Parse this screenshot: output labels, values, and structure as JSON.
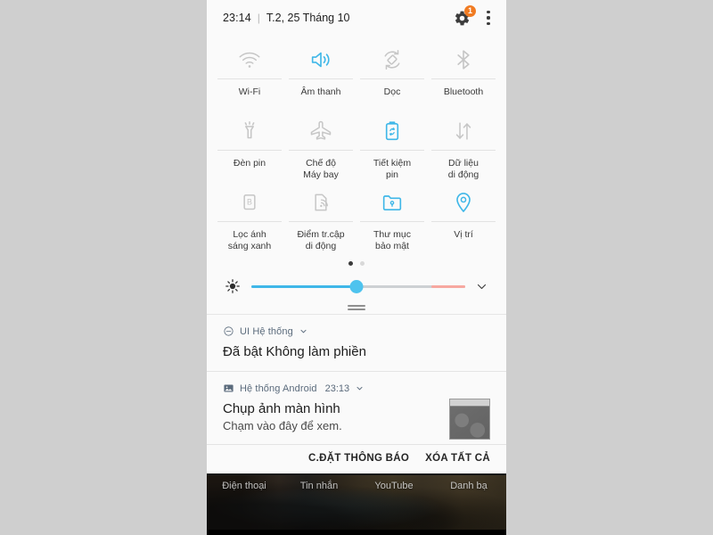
{
  "status_bar": {
    "time": "23:14",
    "separator": "|",
    "date": "T.2, 25 Tháng 10",
    "gear_icon": "gear-icon",
    "gear_badge_count": "1",
    "overflow_icon": "kebab-menu-icon"
  },
  "quick_settings": {
    "accent_on_color": "#3fb7e8",
    "off_color": "#c4c4c4",
    "rows": [
      [
        {
          "label": "Wi-Fi",
          "icon": "wifi-icon",
          "state": "off"
        },
        {
          "label": "Âm thanh",
          "icon": "sound-icon",
          "state": "on"
        },
        {
          "label": "Dọc",
          "icon": "auto-rotate-icon",
          "state": "off"
        },
        {
          "label": "Bluetooth",
          "icon": "bluetooth-icon",
          "state": "off"
        }
      ],
      [
        {
          "label": "Đèn pin",
          "icon": "flashlight-icon",
          "state": "off"
        },
        {
          "label": "Chế độ\nMáy bay",
          "icon": "airplane-icon",
          "state": "off"
        },
        {
          "label": "Tiết kiệm\npin",
          "icon": "battery-saver-icon",
          "state": "on"
        },
        {
          "label": "Dữ liệu\ndi động",
          "icon": "mobile-data-icon",
          "state": "off"
        }
      ],
      [
        {
          "label": "Lọc ánh\nsáng xanh",
          "icon": "blue-light-filter-icon",
          "state": "off"
        },
        {
          "label": "Điểm tr.cập\ndi động",
          "icon": "mobile-hotspot-icon",
          "state": "off"
        },
        {
          "label": "Thư mục\nbảo mật",
          "icon": "secure-folder-icon",
          "state": "on"
        },
        {
          "label": "Vị trí",
          "icon": "location-pin-icon",
          "state": "on"
        }
      ]
    ]
  },
  "pager": {
    "total_pages": 2,
    "active_page": 1
  },
  "brightness": {
    "icon": "brightness-icon",
    "value_percent": 49,
    "warn_zone_percent": 16,
    "expand_icon": "chevron-down-icon",
    "fill_color": "#3fb7e8",
    "track_color": "#cdd0d3",
    "warn_color": "#f7a8a0"
  },
  "drag_handle": {
    "icon": "drag-handle-icon"
  },
  "notifications": [
    {
      "app_icon": "do-not-disturb-icon",
      "app_name": "UI Hệ thống",
      "time": "",
      "expand_icon": "chevron-down-icon",
      "title": "Đã bật Không làm phiền",
      "body": "",
      "thumbnail": false
    },
    {
      "app_icon": "image-icon",
      "app_name": "Hệ thống Android",
      "time": "23:13",
      "expand_icon": "chevron-down-icon",
      "title": "Chụp ảnh màn hình",
      "body": "Chạm vào đây để xem.",
      "thumbnail": true,
      "thumbnail_name": "screenshot-thumbnail"
    }
  ],
  "action_bar": {
    "settings_label": "C.ĐẶT THÔNG BÁO",
    "clear_all_label": "XÓA TẤT CẢ"
  },
  "home_screen": {
    "dock": [
      {
        "label": "Điện thoại"
      },
      {
        "label": "Tin nhắn"
      },
      {
        "label": "YouTube"
      },
      {
        "label": "Danh bạ"
      }
    ]
  }
}
